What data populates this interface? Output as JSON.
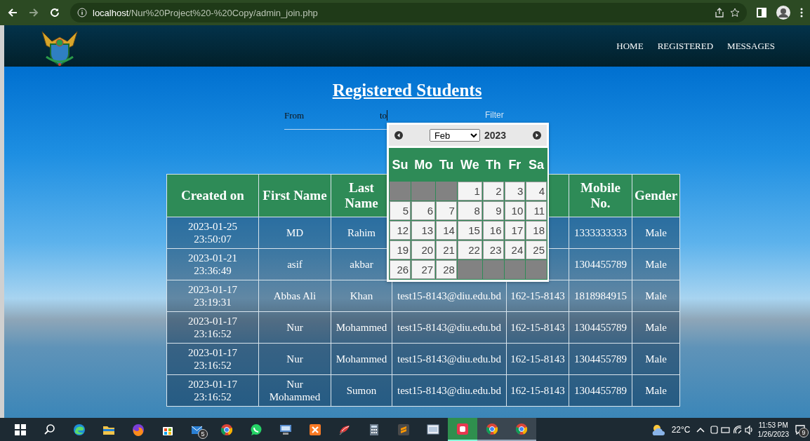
{
  "browser": {
    "url_host": "localhost",
    "url_path": "/Nur%20Project%20-%20Copy/admin_join.php"
  },
  "nav": [
    {
      "label": "HOME"
    },
    {
      "label": "REGISTERED"
    },
    {
      "label": "MESSAGES"
    }
  ],
  "title": "Registered Students",
  "filter": {
    "from_label": "From",
    "to_label": "to",
    "button": "Filter"
  },
  "datepicker": {
    "month": "Feb",
    "year": "2023",
    "weekdays": [
      "Su",
      "Mo",
      "Tu",
      "We",
      "Th",
      "Fr",
      "Sa"
    ],
    "weeks": [
      [
        {
          "kind": "blank"
        },
        {
          "kind": "blank"
        },
        {
          "kind": "blank"
        },
        {
          "kind": "day",
          "label": "1"
        },
        {
          "kind": "day",
          "label": "2"
        },
        {
          "kind": "day",
          "label": "3"
        },
        {
          "kind": "day",
          "label": "4"
        }
      ],
      [
        {
          "kind": "day",
          "label": "5"
        },
        {
          "kind": "day",
          "label": "6"
        },
        {
          "kind": "day",
          "label": "7"
        },
        {
          "kind": "day",
          "label": "8"
        },
        {
          "kind": "day",
          "label": "9"
        },
        {
          "kind": "day",
          "label": "10"
        },
        {
          "kind": "day",
          "label": "11"
        }
      ],
      [
        {
          "kind": "day",
          "label": "12"
        },
        {
          "kind": "day",
          "label": "13"
        },
        {
          "kind": "day",
          "label": "14"
        },
        {
          "kind": "day",
          "label": "15"
        },
        {
          "kind": "day",
          "label": "16"
        },
        {
          "kind": "day",
          "label": "17"
        },
        {
          "kind": "day",
          "label": "18"
        }
      ],
      [
        {
          "kind": "day",
          "label": "19"
        },
        {
          "kind": "day",
          "label": "20"
        },
        {
          "kind": "day",
          "label": "21"
        },
        {
          "kind": "day",
          "label": "22"
        },
        {
          "kind": "day",
          "label": "23"
        },
        {
          "kind": "day",
          "label": "24"
        },
        {
          "kind": "day",
          "label": "25"
        }
      ],
      [
        {
          "kind": "day",
          "label": "26"
        },
        {
          "kind": "day",
          "label": "27"
        },
        {
          "kind": "day",
          "label": "28"
        },
        {
          "kind": "blank"
        },
        {
          "kind": "blank"
        },
        {
          "kind": "blank"
        },
        {
          "kind": "blank"
        }
      ]
    ]
  },
  "table": {
    "columns": [
      "Created on",
      "First Name",
      "Last Name",
      null,
      null,
      "Mobile No.",
      "Gender"
    ],
    "rows": [
      [
        "2023-01-25 23:50:07",
        "MD",
        "Rahim",
        null,
        null,
        "1333333333",
        "Male"
      ],
      [
        "2023-01-21 23:36:49",
        "asif",
        "akbar",
        null,
        null,
        "1304455789",
        "Male"
      ],
      [
        "2023-01-17 23:19:31",
        "Abbas Ali",
        "Khan",
        "test15-8143@diu.edu.bd",
        "162-15-8143",
        "1818984915",
        "Male"
      ],
      [
        "2023-01-17 23:16:52",
        "Nur",
        "Mohammed",
        "test15-8143@diu.edu.bd",
        "162-15-8143",
        "1304455789",
        "Male"
      ],
      [
        "2023-01-17 23:16:52",
        "Nur",
        "Mohammed",
        "test15-8143@diu.edu.bd",
        "162-15-8143",
        "1304455789",
        "Male"
      ],
      [
        "2023-01-17 23:16:52",
        "Nur Mohammed",
        "Sumon",
        "test15-8143@diu.edu.bd",
        "162-15-8143",
        "1304455789",
        "Male"
      ]
    ]
  },
  "taskbar": {
    "apps": [
      {
        "kind": "windows",
        "active": false,
        "open": false
      },
      {
        "kind": "search",
        "active": false,
        "open": false
      },
      {
        "kind": "swirl",
        "active": false,
        "open": false
      },
      {
        "kind": "folder",
        "active": false,
        "open": false
      },
      {
        "kind": "fox",
        "active": false,
        "open": false
      },
      {
        "kind": "bag",
        "active": false,
        "open": false
      },
      {
        "kind": "mail",
        "active": false,
        "open": false,
        "badge": "5"
      },
      {
        "kind": "wheel",
        "active": false,
        "open": false
      },
      {
        "kind": "chat",
        "active": false,
        "open": false
      },
      {
        "kind": "monitor",
        "active": false,
        "open": false
      },
      {
        "kind": "xsquare",
        "active": false,
        "open": false
      },
      {
        "kind": "feather",
        "active": false,
        "open": false
      },
      {
        "kind": "calculator",
        "active": false,
        "open": false
      },
      {
        "kind": "ssquare",
        "active": false,
        "open": false
      },
      {
        "kind": "window",
        "active": false,
        "open": false
      },
      {
        "kind": "redsquare",
        "active": true,
        "open": true
      },
      {
        "kind": "wheel",
        "active": false,
        "open": true
      },
      {
        "kind": "wheel",
        "active": false,
        "open": true
      }
    ],
    "temperature": "22°C",
    "time": "11:53 PM",
    "date": "1/26/2023",
    "notifications": "9"
  }
}
